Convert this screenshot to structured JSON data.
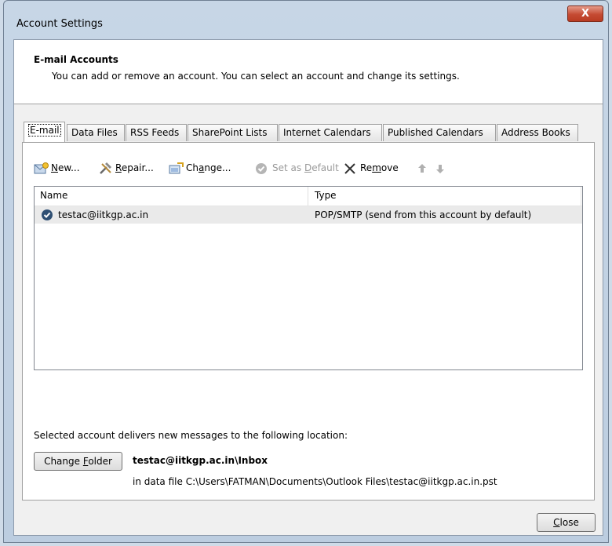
{
  "window": {
    "title": "Account Settings",
    "close_glyph": "X"
  },
  "header": {
    "title": "E-mail Accounts",
    "description": "You can add or remove an account. You can select an account and change its settings."
  },
  "tabs": [
    {
      "label": "E-mail",
      "active": true
    },
    {
      "label": "Data Files"
    },
    {
      "label": "RSS Feeds"
    },
    {
      "label": "SharePoint Lists"
    },
    {
      "label": "Internet Calendars"
    },
    {
      "label": "Published Calendars"
    },
    {
      "label": "Address Books"
    }
  ],
  "toolbar": {
    "new": {
      "pre": "",
      "key": "N",
      "post": "ew...",
      "icon": "new-account-icon"
    },
    "repair": {
      "pre": "",
      "key": "R",
      "post": "epair...",
      "icon": "repair-tools-icon"
    },
    "change": {
      "pre": "Ch",
      "key": "a",
      "post": "nge...",
      "icon": "change-settings-icon"
    },
    "set_default": {
      "pre": "Set as ",
      "key": "D",
      "post": "efault",
      "icon": "checkmark-circle-icon"
    },
    "remove": {
      "pre": "Re",
      "key": "m",
      "post": "ove",
      "icon": "close-x-icon"
    },
    "move_up_icon": "arrow-up-icon",
    "move_down_icon": "arrow-down-icon"
  },
  "list": {
    "columns": [
      "Name",
      "Type"
    ],
    "rows": [
      {
        "name": "testac@iitkgp.ac.in",
        "type": "POP/SMTP (send from this account by default)",
        "default": true
      }
    ]
  },
  "delivery": {
    "label": "Selected account delivers new messages to the following location:",
    "change_folder": {
      "pre": "Change ",
      "key": "F",
      "post": "older"
    },
    "folder": "testac@iitkgp.ac.in\\Inbox",
    "data_file": "in data file C:\\Users\\FATMAN\\Documents\\Outlook Files\\testac@iitkgp.ac.in.pst"
  },
  "footer": {
    "close": {
      "pre": "",
      "key": "C",
      "post": "lose"
    }
  },
  "colors": {
    "titlebar": "#c7d6e6",
    "close_button": "#c54b33",
    "selected_row": "#eaeaea"
  }
}
